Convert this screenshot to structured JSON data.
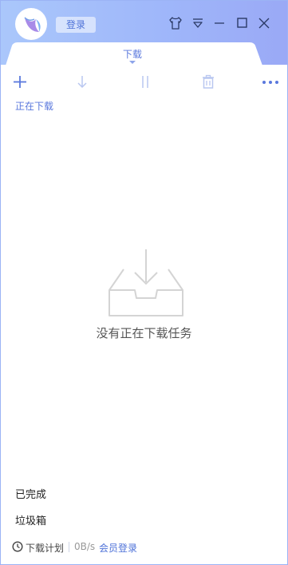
{
  "app": {
    "login_label": "登录",
    "icons": {
      "logo": "bird-logo-icon",
      "skin": "tshirt-icon",
      "menu": "menu-dropdown-icon",
      "minimize": "minimize-icon",
      "maximize": "maximize-icon",
      "close": "close-icon"
    },
    "colors": {
      "accent": "#5a78dd",
      "header_gradient_start": "#aac7fb",
      "header_gradient_end": "#9aa9f6"
    }
  },
  "tabs": [
    {
      "label": "下载",
      "active": true
    }
  ],
  "toolbar": {
    "icons": [
      "plus-icon",
      "download-arrow-icon",
      "pause-icon",
      "trash-icon",
      "more-icon"
    ]
  },
  "section": {
    "downloading_label": "正在下载"
  },
  "empty_state": {
    "icon": "empty-inbox-icon",
    "message": "没有正在下载任务"
  },
  "sidebar": {
    "items": [
      {
        "label": "已完成"
      },
      {
        "label": "垃圾箱"
      }
    ]
  },
  "footer": {
    "plan_label": "下载计划",
    "speed": "0B/s",
    "vip_login": "会员登录"
  }
}
